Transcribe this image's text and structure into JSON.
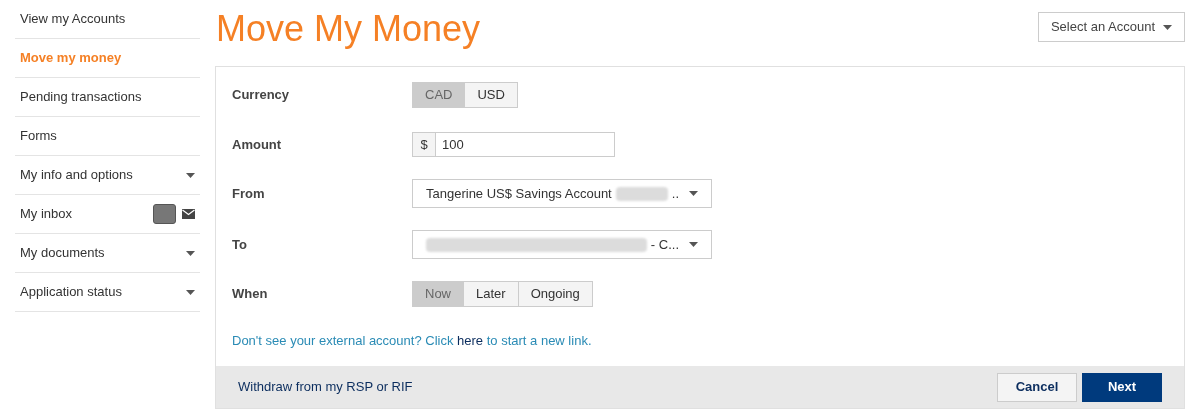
{
  "sidebar": {
    "items": [
      {
        "label": "View my Accounts",
        "kind": "link",
        "selected": false
      },
      {
        "label": "Move my money",
        "kind": "link",
        "selected": true
      },
      {
        "label": "Pending transactions",
        "kind": "link",
        "selected": false
      },
      {
        "label": "Forms",
        "kind": "link",
        "selected": false
      },
      {
        "label": "My info and options",
        "kind": "menu",
        "selected": false
      },
      {
        "label": "My inbox",
        "kind": "inbox",
        "selected": false
      },
      {
        "label": "My documents",
        "kind": "menu",
        "selected": false
      },
      {
        "label": "Application status",
        "kind": "menu",
        "selected": false
      }
    ]
  },
  "page_title": "Move My Money",
  "account_selector": {
    "label": "Select an Account"
  },
  "form": {
    "currency": {
      "label": "Currency",
      "options": [
        {
          "label": "CAD",
          "selected": true
        },
        {
          "label": "USD",
          "selected": false
        }
      ]
    },
    "amount": {
      "label": "Amount",
      "prefix": "$",
      "value": "100"
    },
    "from": {
      "label": "From",
      "value_start": "Tangerine US$ Savings Account",
      "value_end": ".."
    },
    "to": {
      "label": "To",
      "value_end": "- C..."
    },
    "when": {
      "label": "When",
      "options": [
        {
          "label": "Now",
          "selected": true
        },
        {
          "label": "Later",
          "selected": false
        },
        {
          "label": "Ongoing",
          "selected": false
        }
      ]
    },
    "note": {
      "before": "Don't see your external account? Click",
      "link": "here",
      "after": "to start a new link."
    }
  },
  "footer": {
    "link": "Withdraw from my RSP or RIF",
    "buttons": [
      {
        "label": "Cancel",
        "kind": "secondary"
      },
      {
        "label": "Next",
        "kind": "primary"
      }
    ]
  }
}
